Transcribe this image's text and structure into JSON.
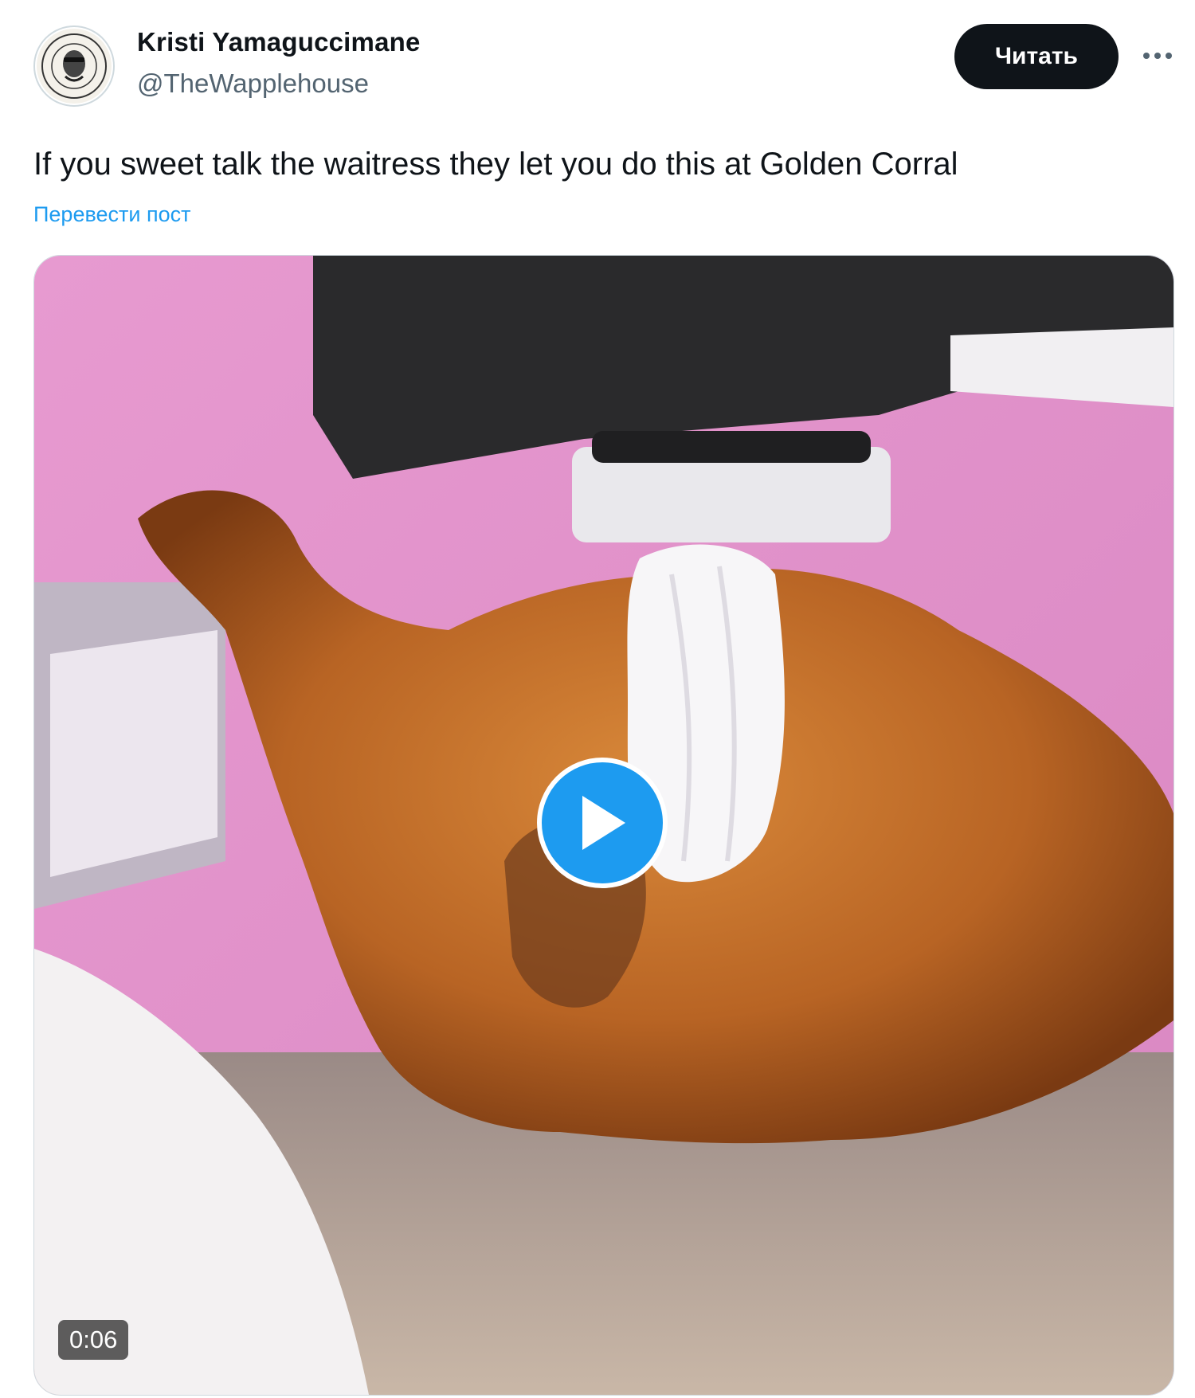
{
  "author": {
    "name": "Kristi Yamaguccimane",
    "handle": "@TheWapplehouse",
    "avatar_icon": "avatar-logo-icon"
  },
  "actions": {
    "follow_label": "Читать",
    "more_icon": "more-dots-icon"
  },
  "tweet": {
    "text": "If you sweet talk the waitress they let you do this at Golden Corral",
    "translate_label": "Перевести пост"
  },
  "media": {
    "type": "video",
    "duration": "0:06",
    "play_icon": "play-icon"
  },
  "colors": {
    "accent": "#1d9bf0",
    "button_dark": "#0f1419",
    "secondary_text": "#536471"
  }
}
